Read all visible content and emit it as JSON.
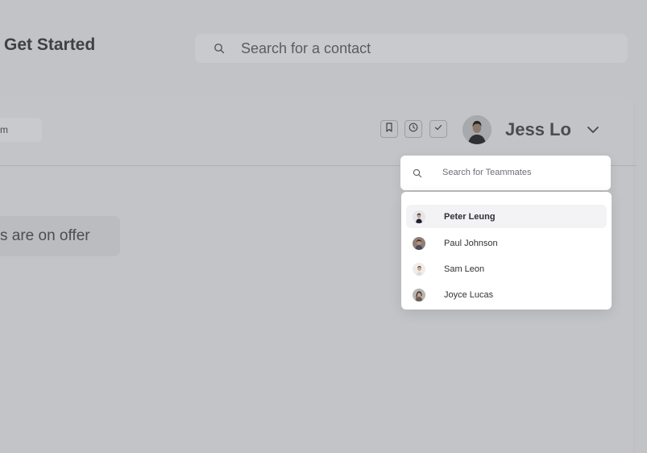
{
  "header": {
    "title": "Get Started",
    "search_placeholder": "Search for a contact"
  },
  "card": {
    "left_chip_text": "m",
    "offer_text": "s are on offer"
  },
  "toolbar": {
    "icons": [
      "bookmark-icon",
      "clock-icon",
      "check-icon"
    ]
  },
  "user": {
    "name": "Jess Lo"
  },
  "team_dropdown": {
    "search_placeholder": "Search for Teammates",
    "members": [
      {
        "name": "Peter Leung"
      },
      {
        "name": "Paul Johnson"
      },
      {
        "name": "Sam Leon"
      },
      {
        "name": "Joyce Lucas"
      }
    ]
  },
  "colors": {
    "overlay": "#c2c3c6",
    "text_dark": "#3e4046",
    "dropdown_bg": "#ffffff"
  }
}
